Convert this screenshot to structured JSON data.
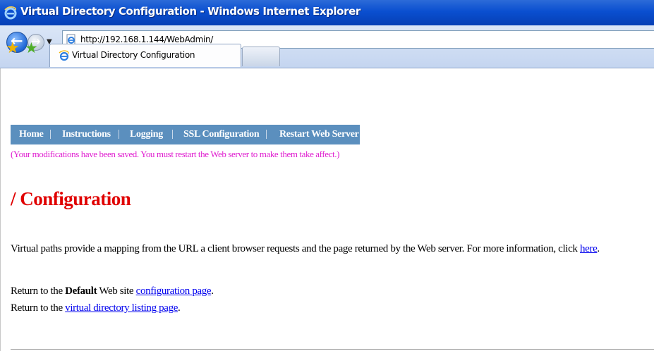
{
  "window": {
    "title": "Virtual Directory Configuration - Windows Internet Explorer"
  },
  "navbar": {
    "url": "http://192.168.1.144/WebAdmin/"
  },
  "tabs": [
    {
      "label": "Virtual Directory Configuration"
    }
  ],
  "menu": {
    "items": [
      "Home",
      "Instructions",
      "Logging",
      "SSL Configuration",
      "Restart Web Server"
    ],
    "separator": "|"
  },
  "content": {
    "saved_message": "(Your modifications have been saved. You must restart the Web server to make them take affect.)",
    "heading": "/ Configuration",
    "description": "Virtual paths provide a mapping from the URL a client browser requests and the page returned by the Web server. For more information, click ",
    "description_link": "here",
    "description_end": ".",
    "return_default_prefix": "Return to the ",
    "return_default_bold": "Default",
    "return_default_mid": " Web site ",
    "return_default_link": "configuration page",
    "return_default_end": ".",
    "return_listing_prefix": "Return to the ",
    "return_listing_link": "virtual directory listing page",
    "return_listing_end": "."
  },
  "colors": {
    "menu_bar": "#5b8fbe",
    "saved_message": "#e020d0",
    "heading": "#e00000",
    "link": "#0000ee"
  }
}
